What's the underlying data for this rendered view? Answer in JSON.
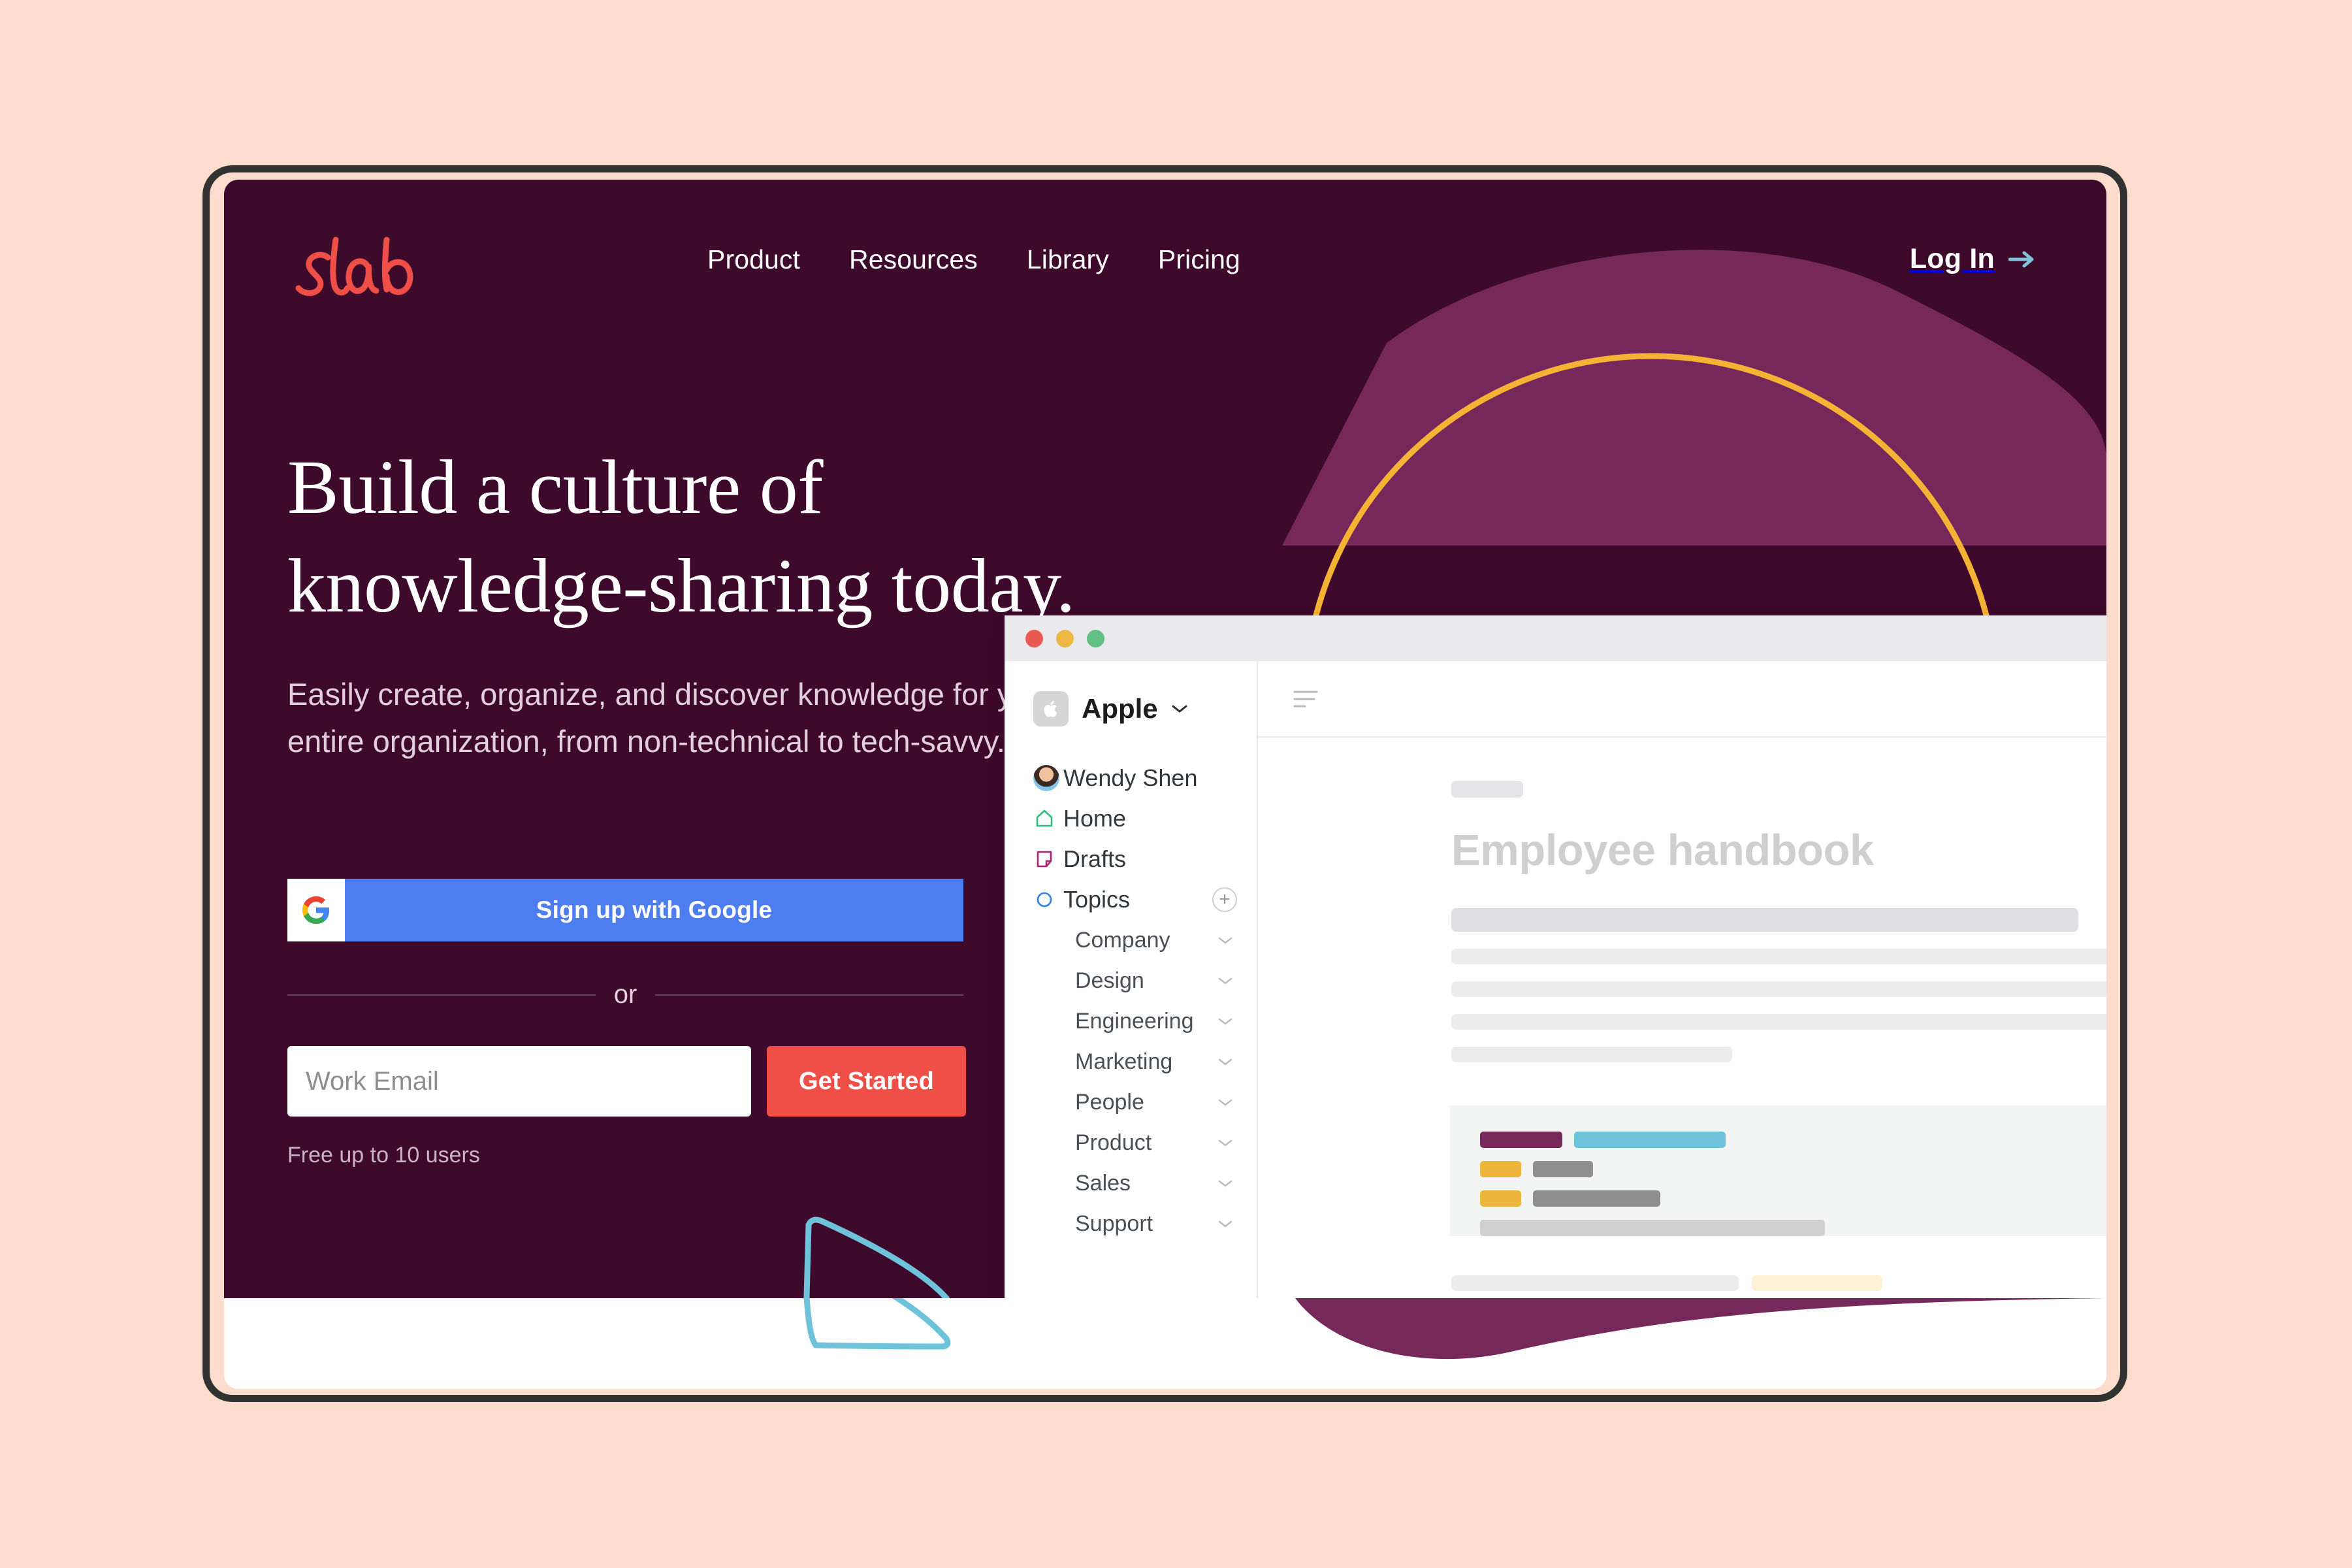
{
  "theme": {
    "page_bg": "#fcdccd",
    "frame_border": "#333232",
    "hero_bg": "#3d0a2b",
    "brand_red": "#ef4f47",
    "google_blue": "#4e7df0",
    "accent_yellow": "#f5b335",
    "accent_teal": "#6ec2da",
    "accent_plum": "#76285a",
    "login_arrow": "#7fc4da"
  },
  "nav": {
    "logo_text": "slab",
    "links": [
      {
        "label": "Product"
      },
      {
        "label": "Resources"
      },
      {
        "label": "Library"
      },
      {
        "label": "Pricing"
      }
    ],
    "login_label": "Log In",
    "login_arrow_icon": "arrow-right-icon"
  },
  "hero": {
    "headline": "Build a culture of\nknowledge-sharing today.",
    "subheadline": "Easily create, organize, and discover knowledge for your\nentire organization, from non-technical to tech-savvy.",
    "google_button_label": "Sign up with Google",
    "google_icon": "google-g-icon",
    "divider_label": "or",
    "email_placeholder": "Work Email",
    "email_value": "",
    "get_started_label": "Get Started",
    "free_note": "Free up to 10 users"
  },
  "app_mockup": {
    "window_controls": [
      "close",
      "minimize",
      "maximize"
    ],
    "sidebar": {
      "workspace_name": "Apple",
      "workspace_logo_icon": "apple-logo-icon",
      "workspace_caret_icon": "chevron-down-icon",
      "user": {
        "name": "Wendy Shen",
        "avatar_icon": "user-avatar"
      },
      "nav_items": [
        {
          "label": "Home",
          "icon": "home-icon",
          "color": "#2fbf7a"
        },
        {
          "label": "Drafts",
          "icon": "draft-document-icon",
          "color": "#a8246c"
        },
        {
          "label": "Topics",
          "icon": "circle-icon",
          "color": "#2b7ff0",
          "add_button": "+"
        }
      ],
      "topics": [
        {
          "label": "Company",
          "caret": "chevron-down-icon"
        },
        {
          "label": "Design",
          "caret": "chevron-down-icon"
        },
        {
          "label": "Engineering",
          "caret": "chevron-down-icon"
        },
        {
          "label": "Marketing",
          "caret": "chevron-down-icon"
        },
        {
          "label": "People",
          "caret": "chevron-down-icon"
        },
        {
          "label": "Product",
          "caret": "chevron-down-icon"
        },
        {
          "label": "Sales",
          "caret": "chevron-down-icon"
        },
        {
          "label": "Support",
          "caret": "chevron-down-icon"
        }
      ]
    },
    "document": {
      "toolbar_icon": "text-align-left-icon",
      "title": "Employee handbook",
      "code_block_chip_colors": [
        "#76285a",
        "#6ec2da",
        "#edb53c",
        "#8e8e8e",
        "#edb53c",
        "#8e8e8e",
        "#cfcfcf"
      ],
      "highlight_color": "#fdf2d6"
    }
  }
}
